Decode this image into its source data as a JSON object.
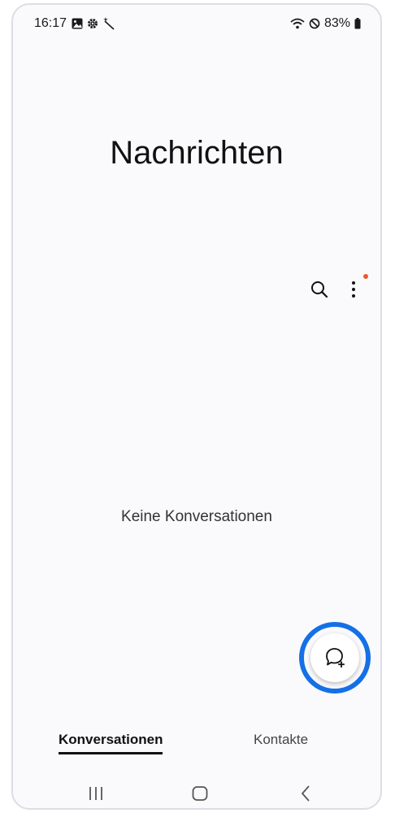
{
  "status_bar": {
    "time": "16:17",
    "battery": "83%",
    "left_icons": [
      "gallery-icon",
      "gear-icon",
      "magic-wand-icon"
    ],
    "right_icons": [
      "wifi-icon",
      "do-not-disturb-icon",
      "battery-icon"
    ]
  },
  "app": {
    "title": "Nachrichten"
  },
  "toolbar": {
    "icons": [
      "search-icon",
      "more-options-icon"
    ],
    "has_notification_dot": true
  },
  "main": {
    "empty_text": "Keine Konversationen"
  },
  "fab": {
    "icon": "new-conversation-icon",
    "highlight_color": "#1470e6"
  },
  "tabs": [
    {
      "label": "Konversationen",
      "active": true
    },
    {
      "label": "Kontakte",
      "active": false
    }
  ],
  "nav": {
    "icons": [
      "recents-icon",
      "home-icon",
      "back-icon"
    ]
  }
}
